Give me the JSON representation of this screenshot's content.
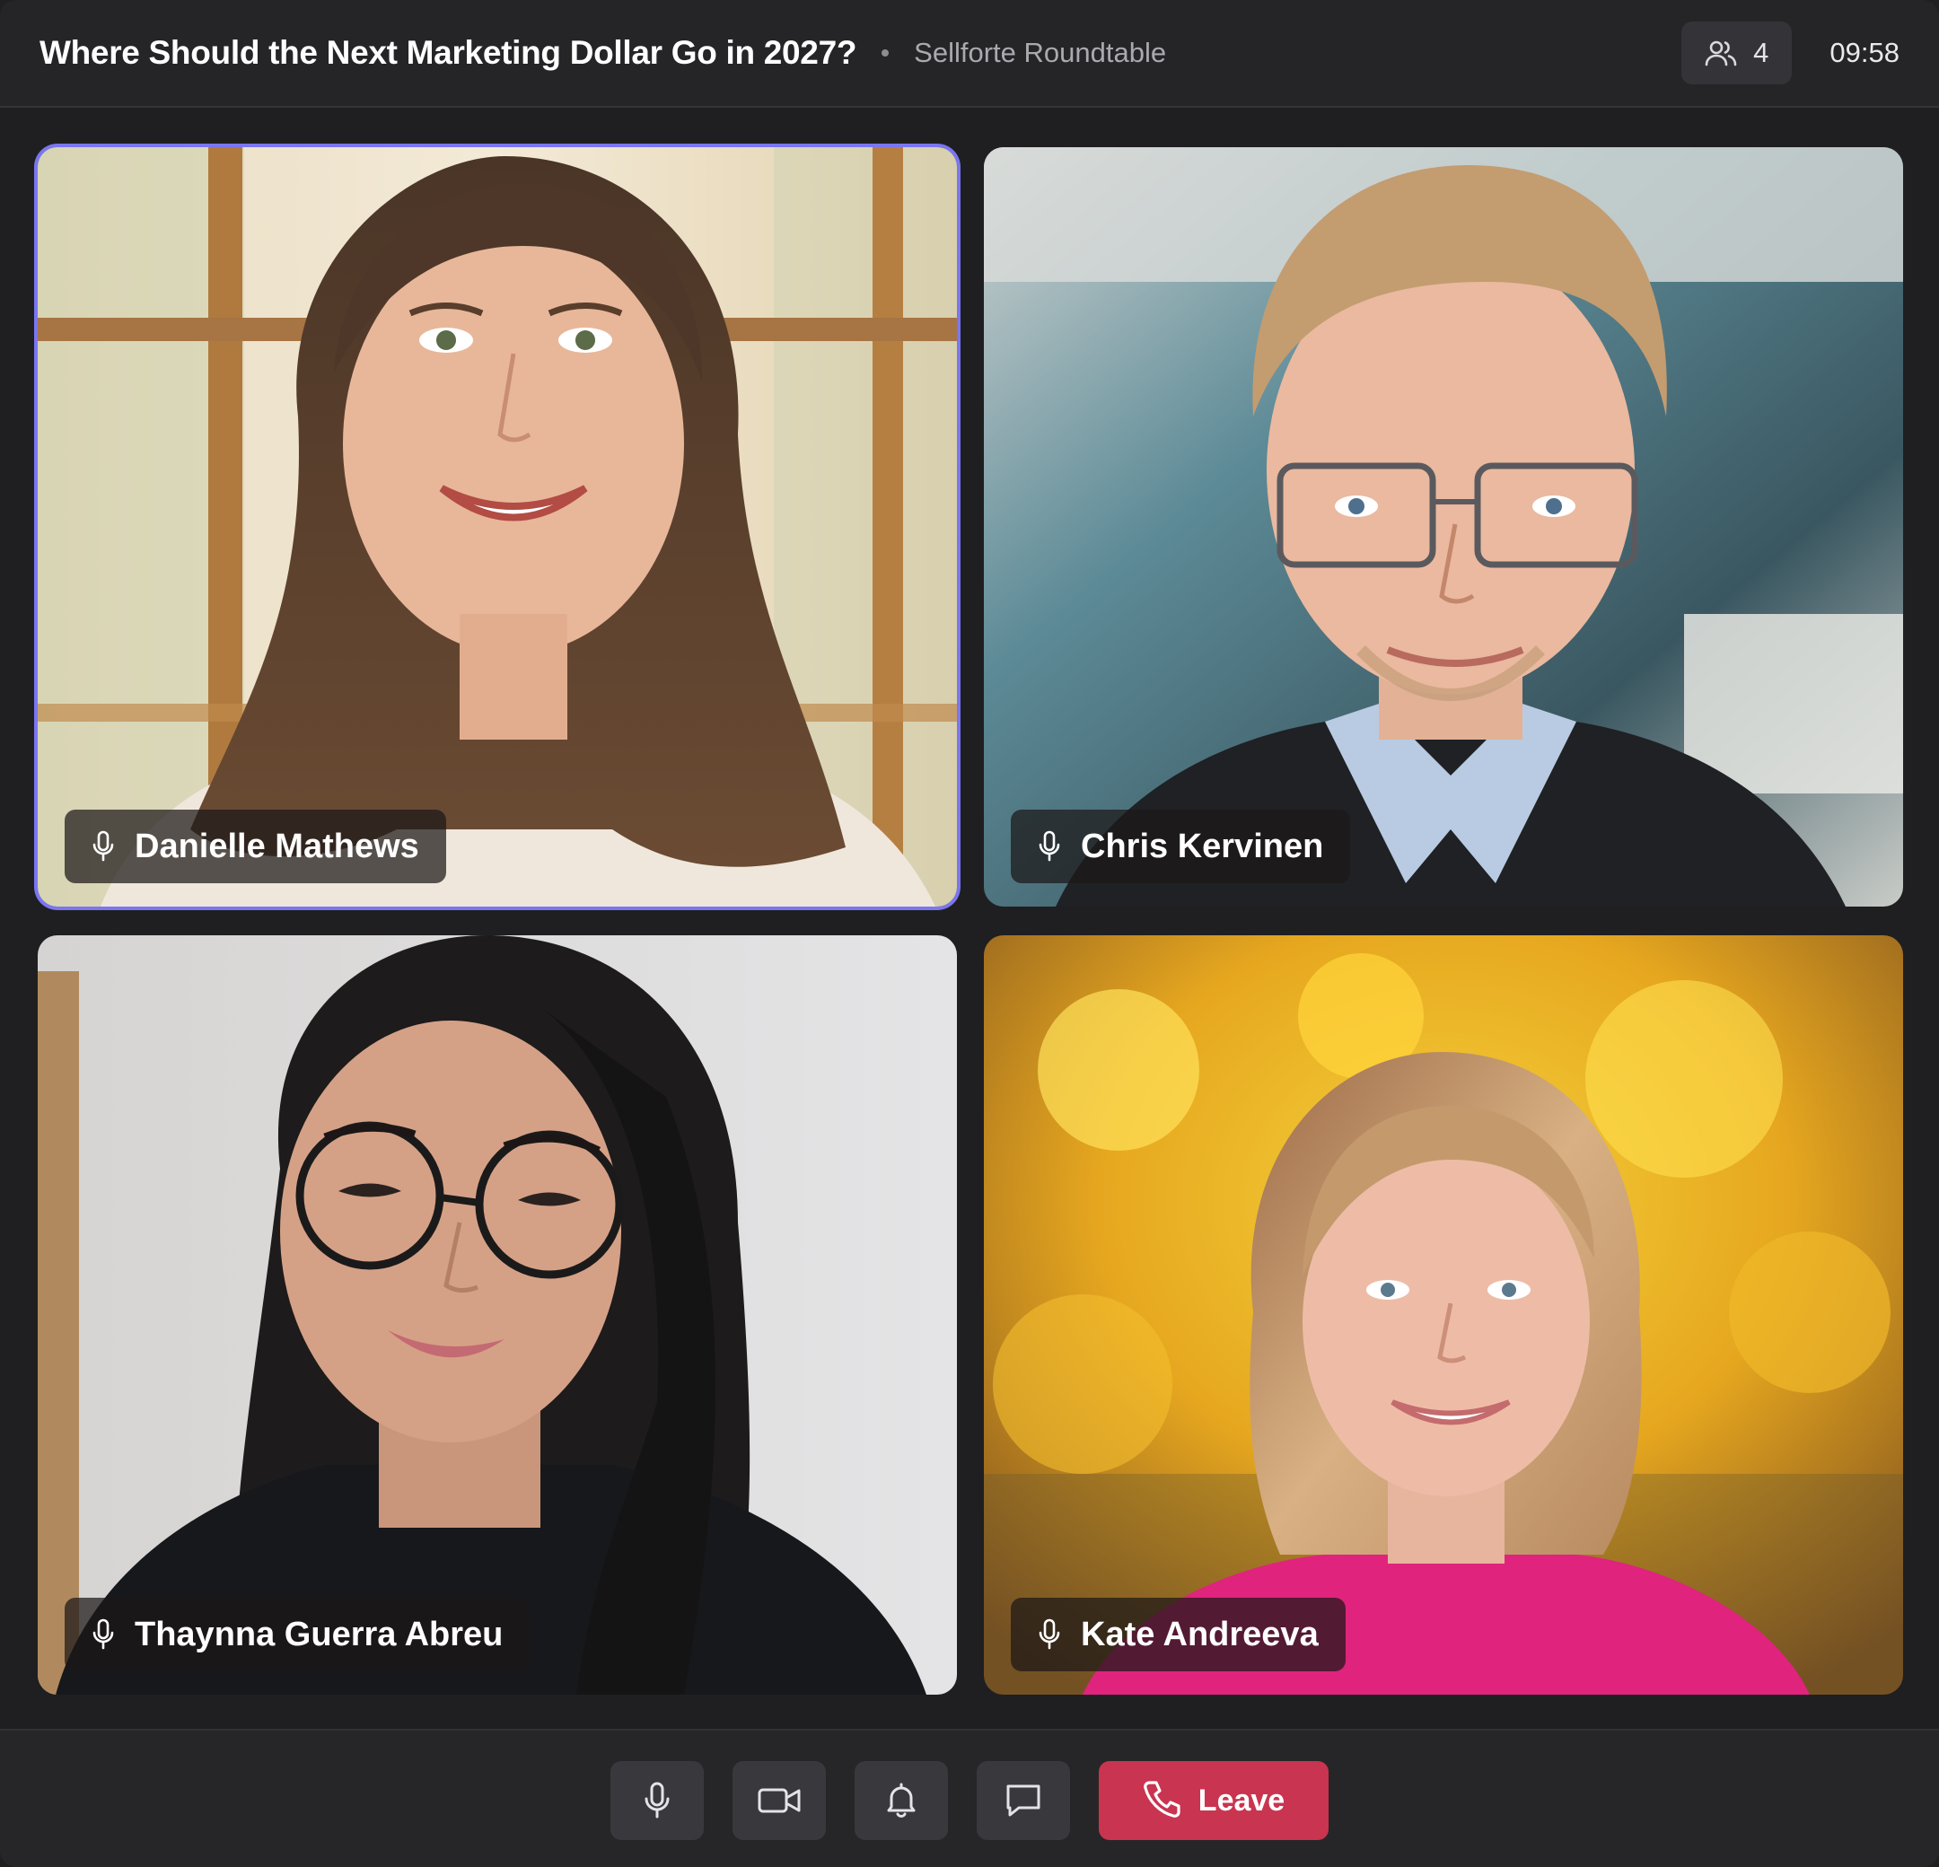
{
  "header": {
    "title": "Where Should the Next Marketing Dollar Go in 2027?",
    "subtitle": "Sellforte Roundtable",
    "participants_icon": "people-icon",
    "participants_count": "4",
    "timer": "09:58"
  },
  "participants": [
    {
      "name": "Danielle Mathews",
      "mic_icon": "microphone-icon",
      "active_speaker": true
    },
    {
      "name": "Chris Kervinen",
      "mic_icon": "microphone-icon",
      "active_speaker": false
    },
    {
      "name": "Thaynna Guerra Abreu",
      "mic_icon": "microphone-icon",
      "active_speaker": false
    },
    {
      "name": "Kate Andreeva",
      "mic_icon": "microphone-icon",
      "active_speaker": false
    }
  ],
  "controls": {
    "mic_icon": "microphone-icon",
    "camera_icon": "video-camera-icon",
    "notifications_icon": "bell-icon",
    "chat_icon": "chat-bubble-icon",
    "leave_icon": "phone-icon",
    "leave_label": "Leave"
  },
  "colors": {
    "background": "#1f1f21",
    "header_bar": "#252527",
    "active_speaker_border": "#7a76f0",
    "leave_button": "#c93450",
    "control_button": "#39393d"
  }
}
